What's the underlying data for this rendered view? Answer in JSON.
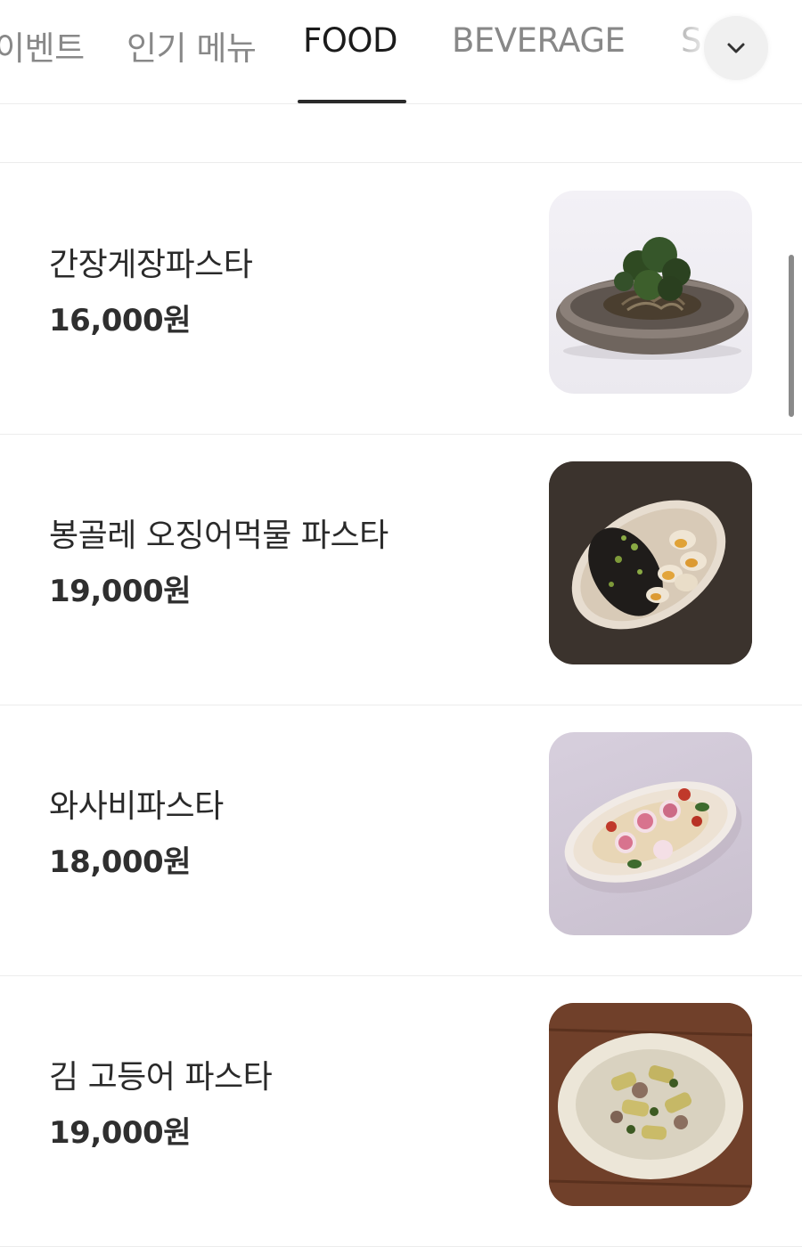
{
  "tabs": [
    {
      "label": "이벤트",
      "active": false
    },
    {
      "label": "인기 메뉴",
      "active": false
    },
    {
      "label": "FOOD",
      "active": true
    },
    {
      "label": "BEVERAGE",
      "active": false
    },
    {
      "label": "S",
      "active": false
    }
  ],
  "expand_icon": "chevron-down-icon",
  "items": [
    {
      "name": "간장게장파스타",
      "price": "16,000원"
    },
    {
      "name": "봉골레 오징어먹물 파스타",
      "price": "19,000원"
    },
    {
      "name": "와사비파스타",
      "price": "18,000원"
    },
    {
      "name": "김 고등어 파스타",
      "price": "19,000원"
    }
  ],
  "colors": {
    "active_tab": "#1b1b1b",
    "inactive_tab": "#888888",
    "divider": "#ececec"
  }
}
